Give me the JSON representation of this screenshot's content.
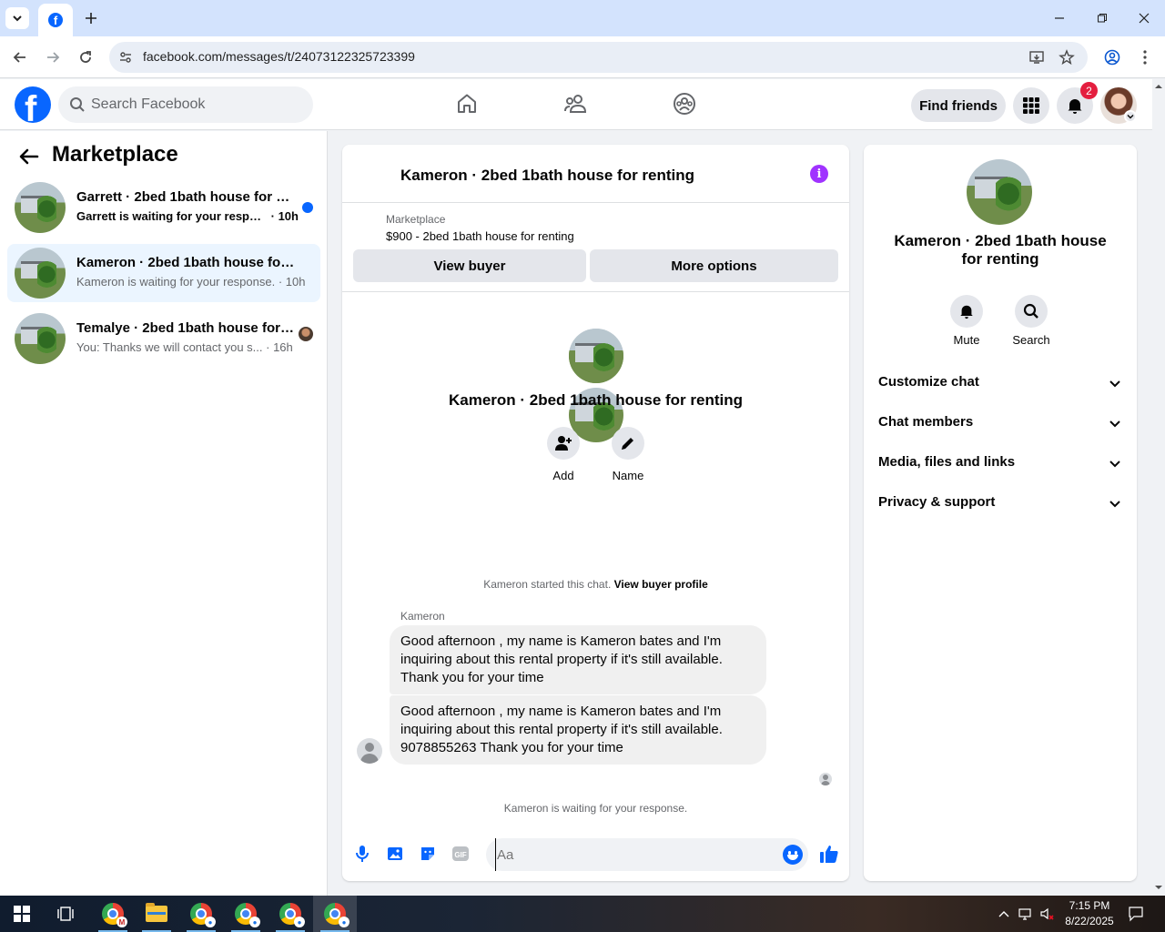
{
  "browser": {
    "url": "facebook.com/messages/t/24073122325723399"
  },
  "fb": {
    "search_placeholder": "Search Facebook",
    "find_friends": "Find friends",
    "notification_count": "2"
  },
  "sidebar": {
    "title": "Marketplace",
    "conversations": [
      {
        "title": "Garrett · 2bed 1bath house for re...",
        "snippet": "Garrett is waiting for your respon...",
        "time": "· 10h",
        "unread": true
      },
      {
        "title": "Kameron · 2bed 1bath house for re...",
        "snippet": "Kameron is waiting for your response.",
        "time": "· 10h",
        "active": true
      },
      {
        "title": "Temalye · 2bed 1bath house for ...",
        "snippet": "You: Thanks we will contact you s...",
        "time": "· 16h"
      }
    ]
  },
  "chat": {
    "title": "Kameron · 2bed 1bath house for renting",
    "listing_label": "Marketplace",
    "listing_price": "$900 - 2bed 1bath house for renting",
    "view_buyer": "View buyer",
    "more_options": "More options",
    "center_title": "Kameron · 2bed 1bath house for renting",
    "add_label": "Add",
    "name_label": "Name",
    "started_text": "Kameron started this chat.",
    "view_buyer_profile": "View buyer profile",
    "sender": "Kameron",
    "messages": [
      "Good afternoon , my name is Kameron bates and I'm inquiring about this rental property if it's still available. Thank you for your time",
      "Good afternoon , my name is Kameron bates and I'm inquiring about this rental property if it's still available. 9078855263  Thank you for your time"
    ],
    "waiting_text": "Kameron is waiting for your response.",
    "compose_placeholder": "Aa"
  },
  "details": {
    "title": "Kameron · 2bed 1bath house for renting",
    "mute": "Mute",
    "search": "Search",
    "sections": [
      "Customize chat",
      "Chat members",
      "Media, files and links",
      "Privacy & support"
    ]
  },
  "taskbar": {
    "time": "7:15 PM",
    "date": "8/22/2025"
  },
  "colors": {
    "fb_blue": "#0866ff",
    "active_row": "#ebf5ff",
    "info_purple": "#a033ff",
    "badge_red": "#e41e3f"
  }
}
